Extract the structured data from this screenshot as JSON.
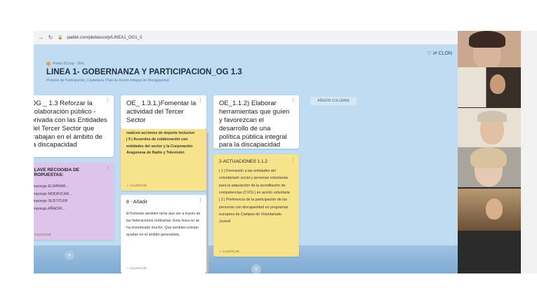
{
  "browser": {
    "url": "padlet.com/plebiascorp/LINEA1_OG1_3",
    "back_icon": "arrow-right-icon",
    "reload_icon": "reload-icon"
  },
  "board": {
    "author": "Plebia SCoop · 30m",
    "title": "LINEA 1- GOBERNANZA Y PARTICIPACION_OG 1.3",
    "subtitle": "Proceso de Participación_Ciudadana: Plan de Acción Integral de Discapacidad",
    "header_right": "♡  ⇄ CLON",
    "add_column": "AÑADIR COLUMNA",
    "background": "#bfdcf3"
  },
  "columns": [
    {
      "header": "OG _ 1.3 Reforzar la colaboración público - privada con las Entidades del Tercer Sector que trabajan en el ámbito de la discapacidad",
      "cards": [
        {
          "color": "#dec4ea",
          "title": "CLAVE RECOGIDA DE PROPUESTAS:",
          "lines": [
            "Propongo ELIMINAR...",
            "Propongo MODIFICAR...",
            "Propongo SUSTITUIR",
            "Propongo AÑADIR..."
          ],
          "action": "CALIFICAR"
        }
      ]
    },
    {
      "header": "OE_ 1.3.1.)Fomentar la actividad del Tercer Sector",
      "cards": [
        {
          "color": "#f6e38b",
          "text_1": "realicen acciones de deporte inclusivo",
          "text_2": "| 9 | Acuerdos de colaboración con entidades del sector y la Corporación Aragonesa de Radio y Televisión",
          "action": "CALIFICAR"
        },
        {
          "color": "#ffffff",
          "title": "8 - Añadir",
          "text": "El fomento también tiene que ser a través de las federaciones ordinarias. Esta línea no se ha incentivado mucho. Que también existan ayudas en el ámbito generalista.",
          "action": "CALIFICAR"
        }
      ]
    },
    {
      "header": "OE_1.1.2) Elaborar herramientas que guíen y favorezcan el desarrollo de una política pública integral para la discapacidad",
      "cards": [
        {
          "color": "#f6e38b",
          "title": "2-ACTUACIONES 1.1.2",
          "p1": "| 1 | Formación a las entidades del voluntariado social y personas voluntarias para la adquisición de la acreditación de competencias (CVOL) en acción voluntaria",
          "p2": "| 2 | Preferencia de la participación de las personas con discapacidad en programas europeos de Campos de Voluntariado Juvenil",
          "action": "CALIFICAR"
        }
      ]
    }
  ],
  "video_participants": 5
}
